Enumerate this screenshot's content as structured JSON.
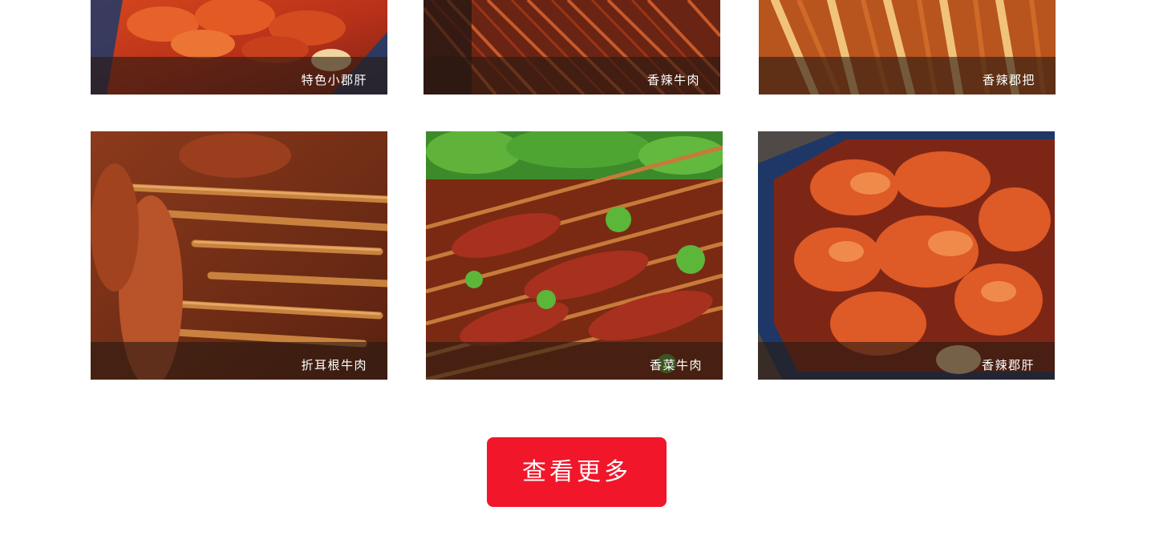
{
  "colors": {
    "accent": "#f2162a",
    "caption_text": "#ffffff",
    "background": "#ffffff"
  },
  "gallery": {
    "items": [
      {
        "label": "特色小郡肝",
        "image": "spicy-chicken-gizzard-in-tray"
      },
      {
        "label": "香辣牛肉",
        "image": "spicy-beef-skewers"
      },
      {
        "label": "香辣郡把",
        "image": "spicy-gizzard-skewers"
      },
      {
        "label": "折耳根牛肉",
        "image": "houttuynia-beef-skewers"
      },
      {
        "label": "香菜牛肉",
        "image": "coriander-beef-skewers"
      },
      {
        "label": "香辣郡肝",
        "image": "spicy-chicken-gizzard-in-tray"
      }
    ]
  },
  "more_button": {
    "label": "查看更多"
  }
}
